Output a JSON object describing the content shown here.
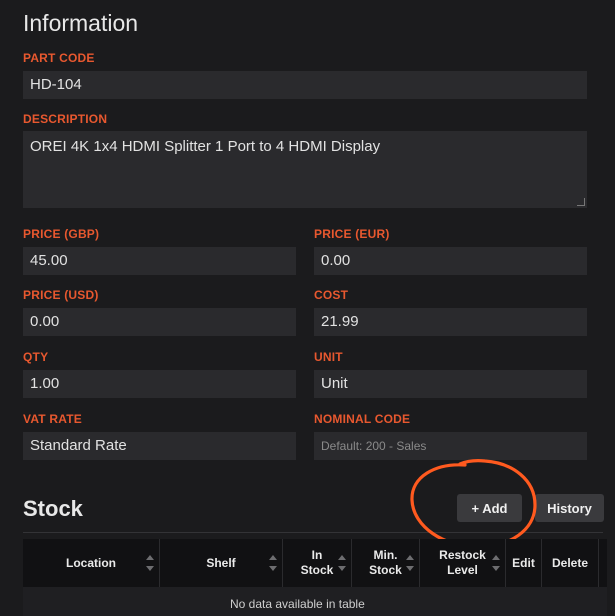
{
  "info": {
    "title": "Information",
    "part_code": {
      "label": "PART CODE",
      "value": "HD-104"
    },
    "description": {
      "label": "DESCRIPTION",
      "value": "OREI 4K 1x4 HDMI Splitter 1 Port to 4 HDMI Display"
    },
    "price_gbp": {
      "label": "PRICE (GBP)",
      "value": "45.00"
    },
    "price_eur": {
      "label": "PRICE (EUR)",
      "value": "0.00"
    },
    "price_usd": {
      "label": "PRICE (USD)",
      "value": "0.00"
    },
    "cost": {
      "label": "COST",
      "value": "21.99"
    },
    "qty": {
      "label": "QTY",
      "value": "1.00"
    },
    "unit": {
      "label": "UNIT",
      "value": "Unit"
    },
    "vat_rate": {
      "label": "VAT RATE",
      "value": "Standard Rate"
    },
    "nominal_code": {
      "label": "NOMINAL CODE",
      "placeholder": "Default: 200 - Sales"
    }
  },
  "stock": {
    "title": "Stock",
    "add_label": "+ Add",
    "history_label": "History",
    "columns": [
      "Location",
      "Shelf",
      "In\nStock",
      "Min.\nStock",
      "Restock\nLevel",
      "Edit",
      "Delete"
    ],
    "empty_text": "No data available in table"
  },
  "colors": {
    "accent": "#e8582f",
    "annotation": "#ff5a1f",
    "background": "#1b1b1d",
    "field": "#2a2a2d"
  }
}
